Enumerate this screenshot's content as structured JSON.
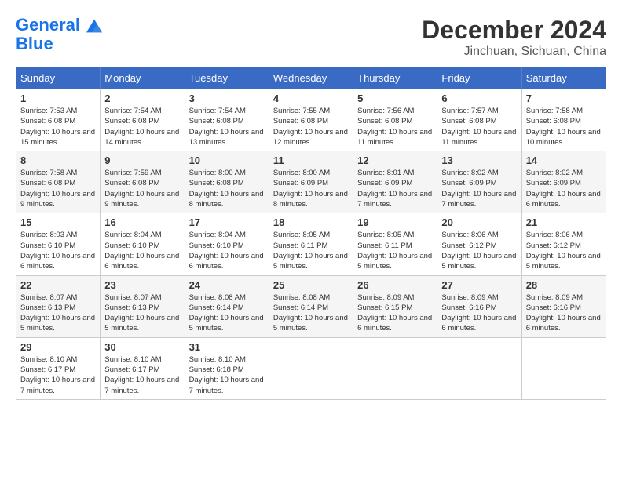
{
  "header": {
    "logo_line1": "General",
    "logo_line2": "Blue",
    "month": "December 2024",
    "location": "Jinchuan, Sichuan, China"
  },
  "days_of_week": [
    "Sunday",
    "Monday",
    "Tuesday",
    "Wednesday",
    "Thursday",
    "Friday",
    "Saturday"
  ],
  "weeks": [
    [
      {
        "day": "1",
        "sunrise": "7:53 AM",
        "sunset": "6:08 PM",
        "daylight": "10 hours and 15 minutes."
      },
      {
        "day": "2",
        "sunrise": "7:54 AM",
        "sunset": "6:08 PM",
        "daylight": "10 hours and 14 minutes."
      },
      {
        "day": "3",
        "sunrise": "7:54 AM",
        "sunset": "6:08 PM",
        "daylight": "10 hours and 13 minutes."
      },
      {
        "day": "4",
        "sunrise": "7:55 AM",
        "sunset": "6:08 PM",
        "daylight": "10 hours and 12 minutes."
      },
      {
        "day": "5",
        "sunrise": "7:56 AM",
        "sunset": "6:08 PM",
        "daylight": "10 hours and 11 minutes."
      },
      {
        "day": "6",
        "sunrise": "7:57 AM",
        "sunset": "6:08 PM",
        "daylight": "10 hours and 11 minutes."
      },
      {
        "day": "7",
        "sunrise": "7:58 AM",
        "sunset": "6:08 PM",
        "daylight": "10 hours and 10 minutes."
      }
    ],
    [
      {
        "day": "8",
        "sunrise": "7:58 AM",
        "sunset": "6:08 PM",
        "daylight": "10 hours and 9 minutes."
      },
      {
        "day": "9",
        "sunrise": "7:59 AM",
        "sunset": "6:08 PM",
        "daylight": "10 hours and 9 minutes."
      },
      {
        "day": "10",
        "sunrise": "8:00 AM",
        "sunset": "6:08 PM",
        "daylight": "10 hours and 8 minutes."
      },
      {
        "day": "11",
        "sunrise": "8:00 AM",
        "sunset": "6:09 PM",
        "daylight": "10 hours and 8 minutes."
      },
      {
        "day": "12",
        "sunrise": "8:01 AM",
        "sunset": "6:09 PM",
        "daylight": "10 hours and 7 minutes."
      },
      {
        "day": "13",
        "sunrise": "8:02 AM",
        "sunset": "6:09 PM",
        "daylight": "10 hours and 7 minutes."
      },
      {
        "day": "14",
        "sunrise": "8:02 AM",
        "sunset": "6:09 PM",
        "daylight": "10 hours and 6 minutes."
      }
    ],
    [
      {
        "day": "15",
        "sunrise": "8:03 AM",
        "sunset": "6:10 PM",
        "daylight": "10 hours and 6 minutes."
      },
      {
        "day": "16",
        "sunrise": "8:04 AM",
        "sunset": "6:10 PM",
        "daylight": "10 hours and 6 minutes."
      },
      {
        "day": "17",
        "sunrise": "8:04 AM",
        "sunset": "6:10 PM",
        "daylight": "10 hours and 6 minutes."
      },
      {
        "day": "18",
        "sunrise": "8:05 AM",
        "sunset": "6:11 PM",
        "daylight": "10 hours and 5 minutes."
      },
      {
        "day": "19",
        "sunrise": "8:05 AM",
        "sunset": "6:11 PM",
        "daylight": "10 hours and 5 minutes."
      },
      {
        "day": "20",
        "sunrise": "8:06 AM",
        "sunset": "6:12 PM",
        "daylight": "10 hours and 5 minutes."
      },
      {
        "day": "21",
        "sunrise": "8:06 AM",
        "sunset": "6:12 PM",
        "daylight": "10 hours and 5 minutes."
      }
    ],
    [
      {
        "day": "22",
        "sunrise": "8:07 AM",
        "sunset": "6:13 PM",
        "daylight": "10 hours and 5 minutes."
      },
      {
        "day": "23",
        "sunrise": "8:07 AM",
        "sunset": "6:13 PM",
        "daylight": "10 hours and 5 minutes."
      },
      {
        "day": "24",
        "sunrise": "8:08 AM",
        "sunset": "6:14 PM",
        "daylight": "10 hours and 5 minutes."
      },
      {
        "day": "25",
        "sunrise": "8:08 AM",
        "sunset": "6:14 PM",
        "daylight": "10 hours and 5 minutes."
      },
      {
        "day": "26",
        "sunrise": "8:09 AM",
        "sunset": "6:15 PM",
        "daylight": "10 hours and 6 minutes."
      },
      {
        "day": "27",
        "sunrise": "8:09 AM",
        "sunset": "6:16 PM",
        "daylight": "10 hours and 6 minutes."
      },
      {
        "day": "28",
        "sunrise": "8:09 AM",
        "sunset": "6:16 PM",
        "daylight": "10 hours and 6 minutes."
      }
    ],
    [
      {
        "day": "29",
        "sunrise": "8:10 AM",
        "sunset": "6:17 PM",
        "daylight": "10 hours and 7 minutes."
      },
      {
        "day": "30",
        "sunrise": "8:10 AM",
        "sunset": "6:17 PM",
        "daylight": "10 hours and 7 minutes."
      },
      {
        "day": "31",
        "sunrise": "8:10 AM",
        "sunset": "6:18 PM",
        "daylight": "10 hours and 7 minutes."
      },
      null,
      null,
      null,
      null
    ]
  ]
}
